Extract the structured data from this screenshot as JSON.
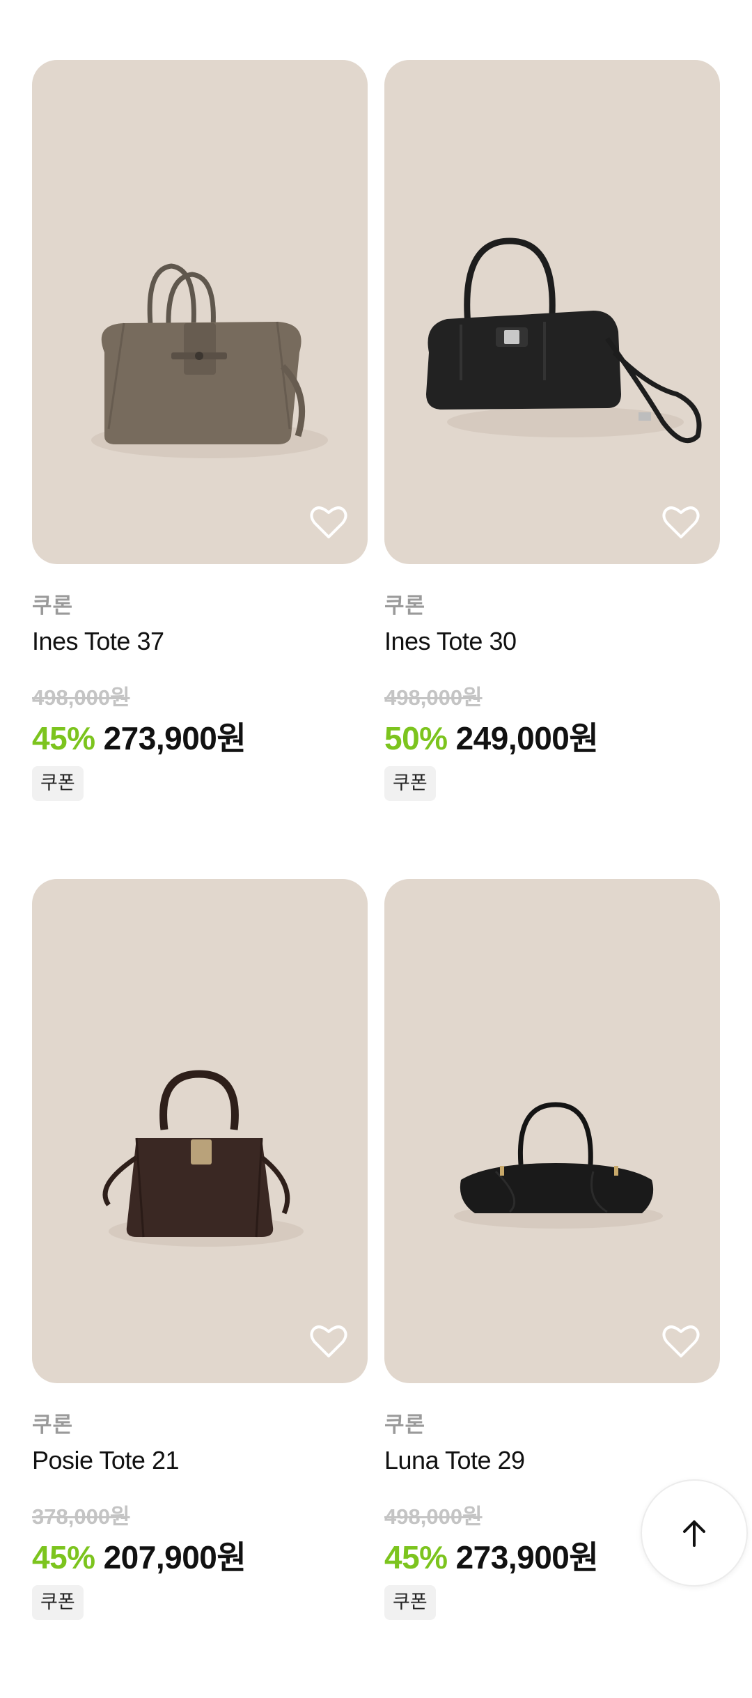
{
  "colors": {
    "card_bg": "#e1d7cd",
    "discount": "#7cc41e",
    "brand_text": "#9a9a9a",
    "strike_price": "#c4c4c4"
  },
  "products": [
    {
      "brand": "쿠론",
      "name": "Ines Tote 37",
      "original_price": "498,000원",
      "discount": "45%",
      "sale_price": "273,900원",
      "badge": "쿠폰",
      "image": "taupe-tote-bag",
      "wish_icon": "heart-outline-icon"
    },
    {
      "brand": "쿠론",
      "name": "Ines Tote 30",
      "original_price": "498,000원",
      "discount": "50%",
      "sale_price": "249,000원",
      "badge": "쿠폰",
      "image": "black-tote-bag-with-strap",
      "wish_icon": "heart-outline-icon"
    },
    {
      "brand": "쿠론",
      "name": "Posie Tote 21",
      "original_price": "378,000원",
      "discount": "45%",
      "sale_price": "207,900원",
      "badge": "쿠폰",
      "image": "brown-croc-tote-bag",
      "wish_icon": "heart-outline-icon"
    },
    {
      "brand": "쿠론",
      "name": "Luna Tote 29",
      "original_price": "498,000원",
      "discount": "45%",
      "sale_price": "273,900원",
      "badge": "쿠폰",
      "image": "black-glossy-tote-bag",
      "wish_icon": "heart-outline-icon"
    }
  ],
  "scroll_top": {
    "icon": "arrow-up-icon"
  }
}
